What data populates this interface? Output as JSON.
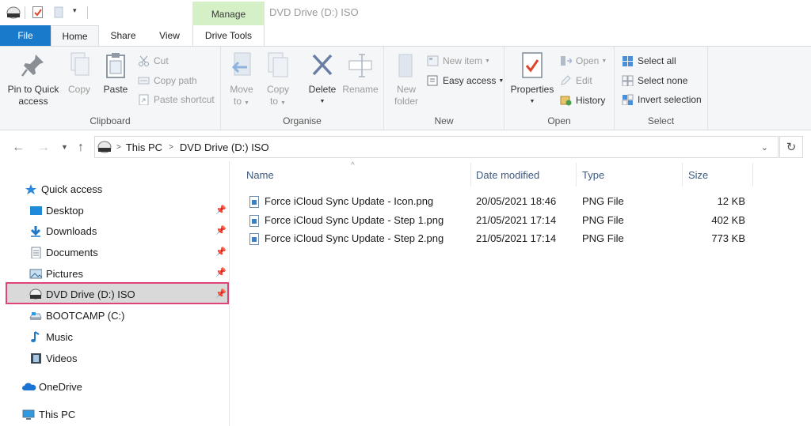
{
  "titlebar": {
    "manage_label": "Manage",
    "window_title": "DVD Drive (D:) ISO"
  },
  "tabs": {
    "file": "File",
    "home": "Home",
    "share": "Share",
    "view": "View",
    "drive_tools": "Drive Tools"
  },
  "ribbon": {
    "clipboard": {
      "label": "Clipboard",
      "pin_line1": "Pin to Quick",
      "pin_line2": "access",
      "copy": "Copy",
      "paste": "Paste",
      "cut": "Cut",
      "copy_path": "Copy path",
      "paste_shortcut": "Paste shortcut"
    },
    "organise": {
      "label": "Organise",
      "move_line1": "Move",
      "move_line2": "to",
      "copy_line1": "Copy",
      "copy_line2": "to",
      "delete": "Delete",
      "rename": "Rename"
    },
    "new": {
      "label": "New",
      "new_folder_line1": "New",
      "new_folder_line2": "folder",
      "new_item": "New item",
      "easy_access": "Easy access"
    },
    "open": {
      "label": "Open",
      "properties": "Properties",
      "open": "Open",
      "edit": "Edit",
      "history": "History"
    },
    "select": {
      "label": "Select",
      "select_all": "Select all",
      "select_none": "Select none",
      "invert_selection": "Invert selection"
    }
  },
  "address": {
    "this_pc": "This PC",
    "location": "DVD Drive (D:) ISO"
  },
  "nav": {
    "quick_access": "Quick access",
    "desktop": "Desktop",
    "downloads": "Downloads",
    "documents": "Documents",
    "pictures": "Pictures",
    "dvd": "DVD Drive (D:) ISO",
    "bootcamp": "BOOTCAMP (C:)",
    "music": "Music",
    "videos": "Videos",
    "onedrive": "OneDrive",
    "this_pc": "This PC"
  },
  "files": {
    "columns": [
      "Name",
      "Date modified",
      "Type",
      "Size"
    ],
    "rows": [
      {
        "name": "Force iCloud Sync Update - Icon.png",
        "date": "20/05/2021 18:46",
        "type": "PNG File",
        "size": "12 KB"
      },
      {
        "name": "Force iCloud Sync Update - Step 1.png",
        "date": "21/05/2021 17:14",
        "type": "PNG File",
        "size": "402 KB"
      },
      {
        "name": "Force iCloud Sync Update - Step 2.png",
        "date": "21/05/2021 17:14",
        "type": "PNG File",
        "size": "773 KB"
      }
    ]
  }
}
